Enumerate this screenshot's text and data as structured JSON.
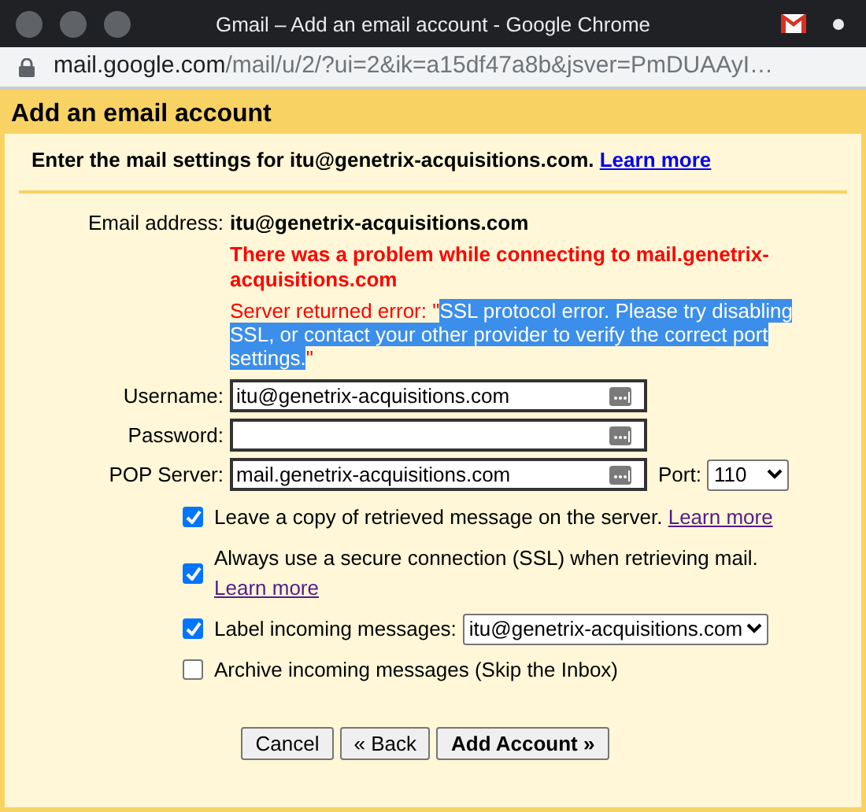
{
  "window": {
    "title": "Gmail – Add an email account - Google Chrome"
  },
  "address_bar": {
    "host": "mail.google.com",
    "path": "/mail/u/2/?ui=2&ik=a15df47a8b&jsver=PmDUAAyI…"
  },
  "dialog": {
    "title": "Add an email account",
    "intro": "Enter the mail settings for itu@genetrix-acquisitions.com.",
    "intro_link": "Learn more"
  },
  "email": {
    "label": "Email address:",
    "value": "itu@genetrix-acquisitions.com"
  },
  "error": {
    "headline": "There was a problem while connecting to mail.genetrix-acquisitions.com",
    "before": "Server returned error: \"",
    "highlighted": "SSL protocol error. Please try disabling SSL, or contact your other provider to verify the correct port settings.",
    "after": "\""
  },
  "fields": [
    {
      "label": "Username:",
      "value": "itu@genetrix-acquisitions.com"
    },
    {
      "label": "Password:"
    },
    {
      "label": "POP Server:",
      "value": "mail.genetrix-acquisitions.com"
    }
  ],
  "port": {
    "label": "Port:",
    "value": "110"
  },
  "options": [
    {
      "kind": "plain",
      "label": "Leave a copy of retrieved message on the server.",
      "link": "Learn more",
      "checked": true
    },
    {
      "kind": "plain",
      "label": "Always use a secure connection (SSL) when retrieving mail.",
      "link": "Learn more",
      "checked": true
    },
    {
      "kind": "select",
      "label": "Label incoming messages:",
      "value": "itu@genetrix-acquisitions.com",
      "checked": true
    },
    {
      "kind": "plain",
      "label": "Archive incoming messages (Skip the Inbox)",
      "checked": false
    }
  ],
  "buttons": [
    {
      "label": "Cancel",
      "primary": false
    },
    {
      "label": "« Back",
      "primary": false
    },
    {
      "label": "Add Account »",
      "primary": true
    }
  ]
}
